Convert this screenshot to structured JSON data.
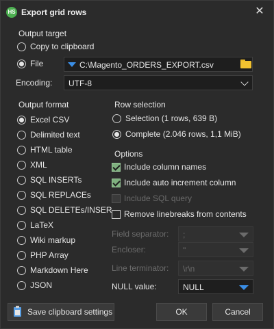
{
  "window": {
    "title": "Export grid rows",
    "app_icon_text": "HS"
  },
  "output_target": {
    "label": "Output target",
    "copy_to_clipboard": "Copy to clipboard",
    "file": "File",
    "file_path": "C:\\Magento_ORDERS_EXPORT.csv",
    "selected": "file"
  },
  "encoding": {
    "label": "Encoding:",
    "value": "UTF-8"
  },
  "output_format": {
    "label": "Output format",
    "options": [
      "Excel CSV",
      "Delimited text",
      "HTML table",
      "XML",
      "SQL INSERTs",
      "SQL REPLACEs",
      "SQL DELETEs/INSER",
      "LaTeX",
      "Wiki markup",
      "PHP Array",
      "Markdown Here",
      "JSON"
    ],
    "selected": "Excel CSV"
  },
  "row_selection": {
    "label": "Row selection",
    "selection": "Selection (1 rows, 639 B)",
    "complete": "Complete (2.046 rows, 1,1 MiB)",
    "selected": "complete"
  },
  "options": {
    "label": "Options",
    "include_column_names": {
      "label": "Include column names",
      "checked": true
    },
    "include_auto_increment": {
      "label": "Include auto increment column",
      "checked": true
    },
    "include_sql_query": {
      "label": "Include SQL query",
      "checked": false,
      "disabled": true
    },
    "remove_linebreaks": {
      "label": "Remove linebreaks from contents",
      "checked": false
    }
  },
  "fields": {
    "field_separator": {
      "label": "Field separator:",
      "value": ";"
    },
    "encloser": {
      "label": "Encloser:",
      "value": "\""
    },
    "line_terminator": {
      "label": "Line terminator:",
      "value": "\\r\\n"
    },
    "null_value": {
      "label": "NULL value:",
      "value": "NULL"
    }
  },
  "buttons": {
    "save_clipboard": "Save clipboard settings",
    "ok": "OK",
    "cancel": "Cancel"
  }
}
